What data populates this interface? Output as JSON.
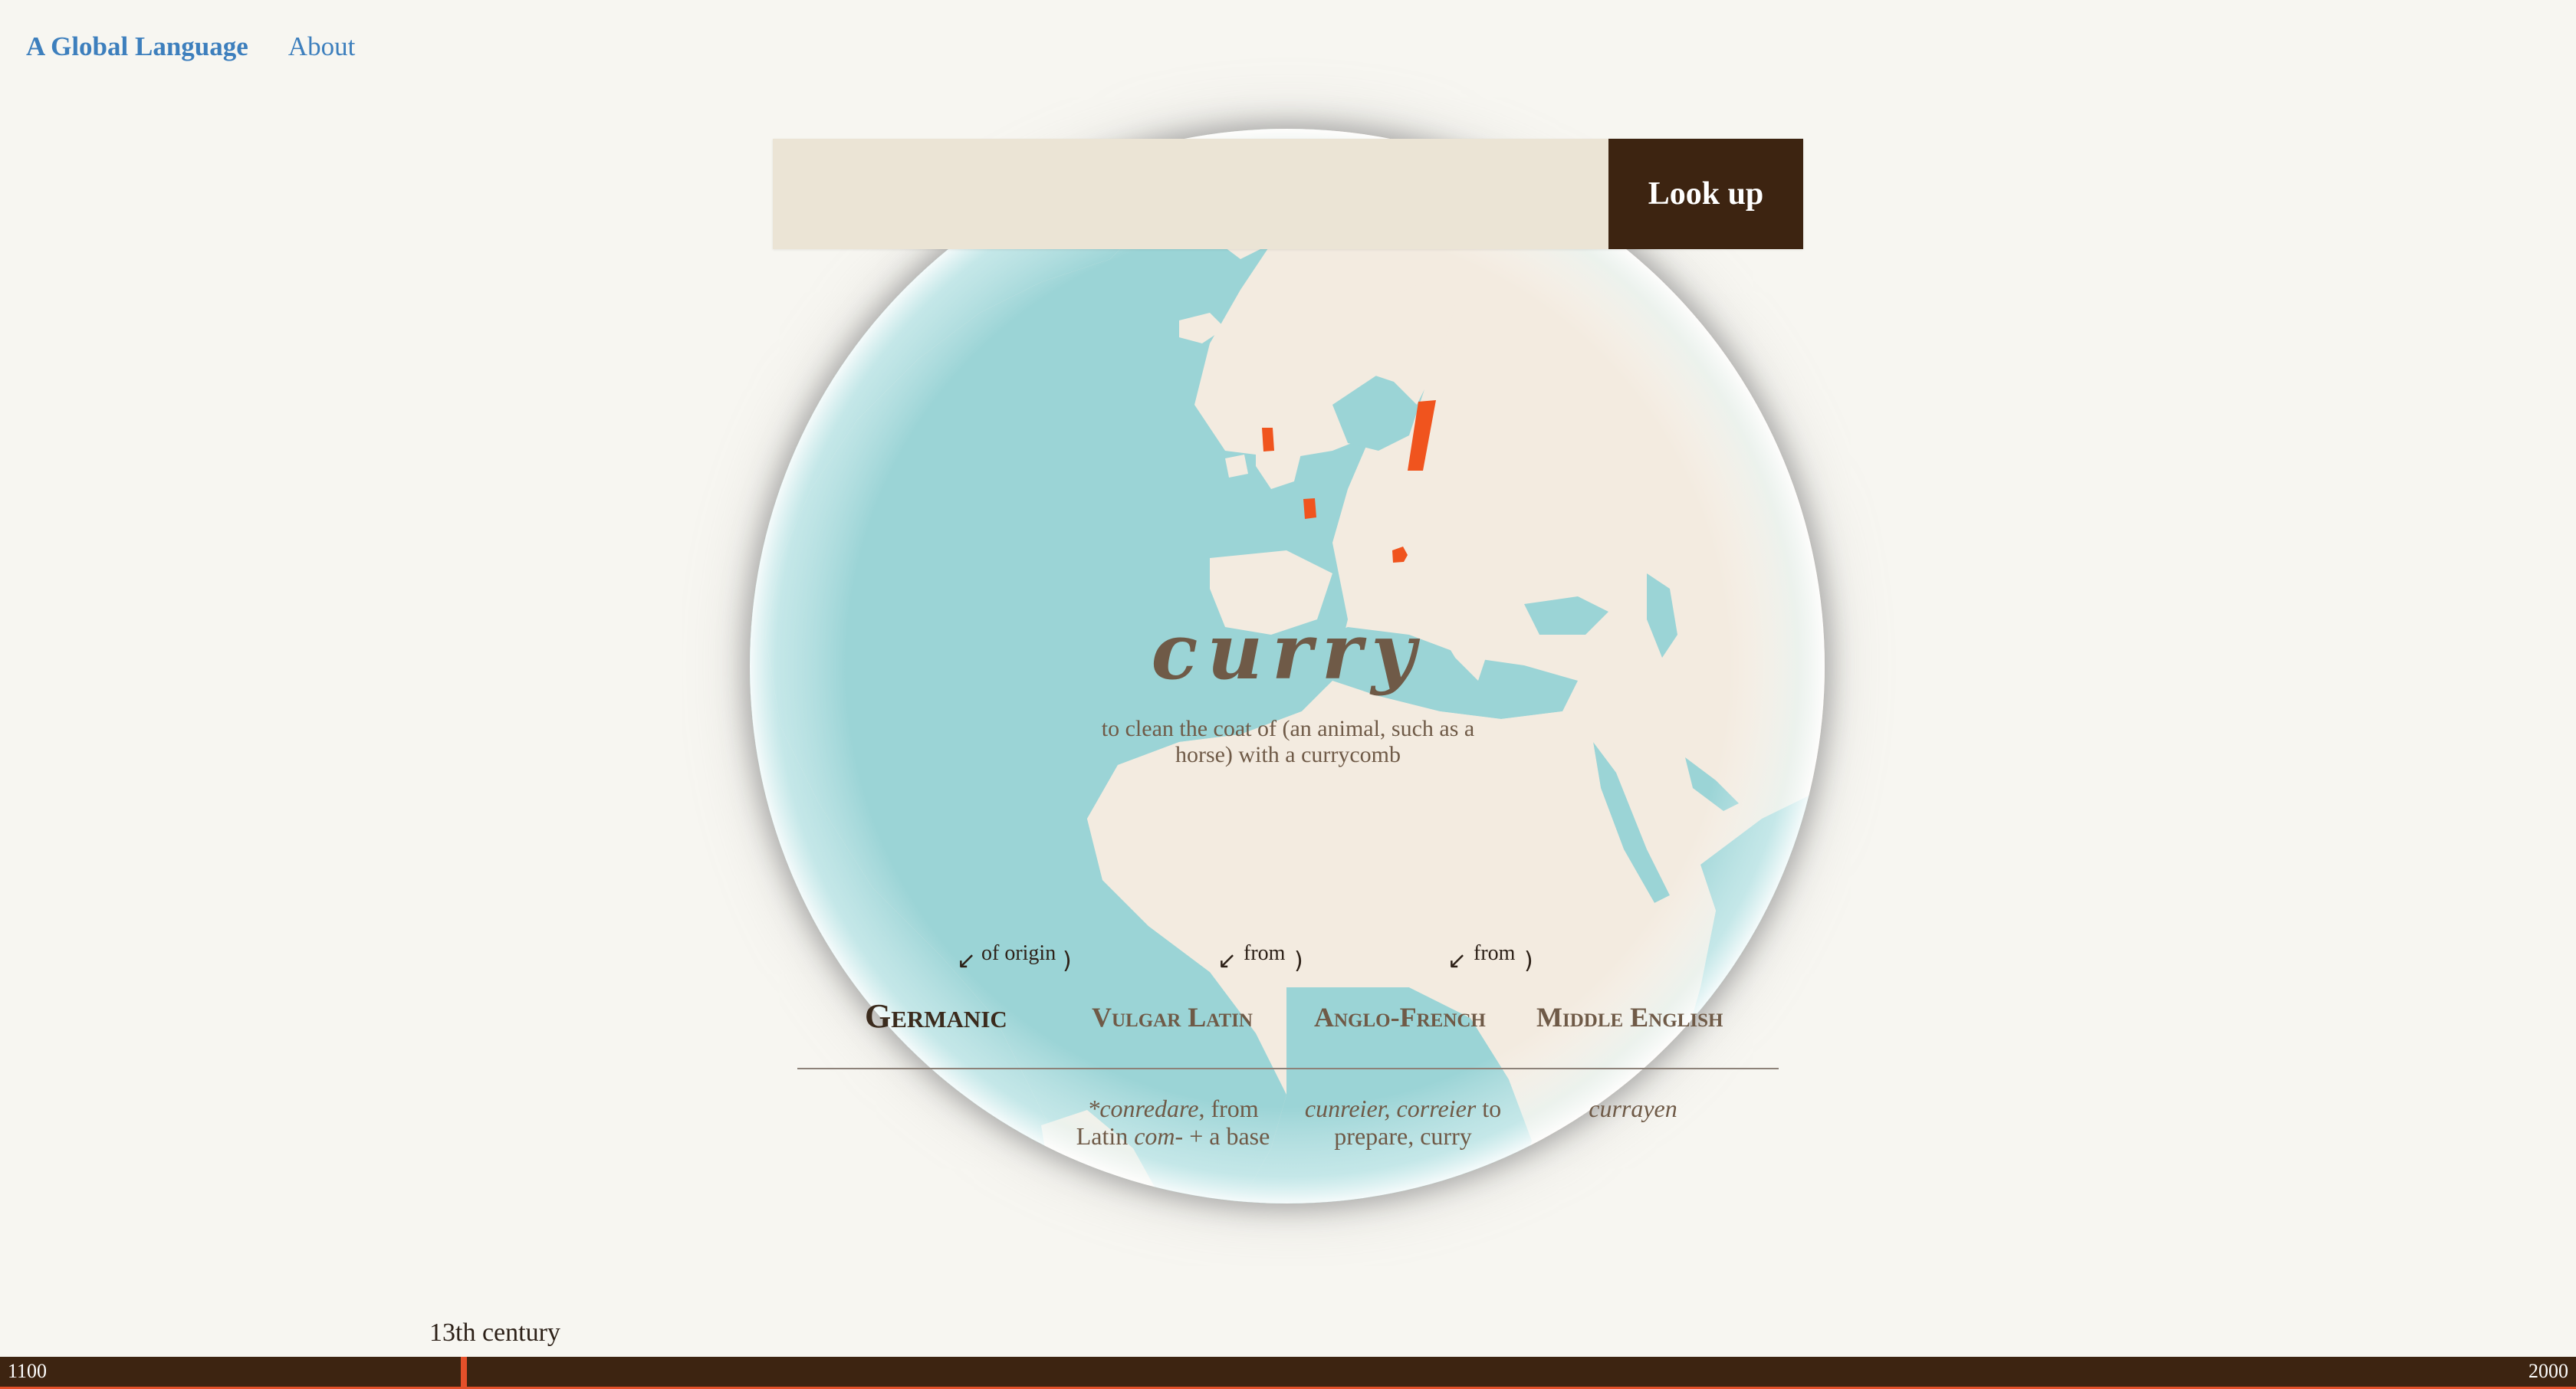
{
  "nav": {
    "brand": "A Global Language",
    "about": "About"
  },
  "search": {
    "value": "",
    "placeholder": "",
    "button_label": "Look up"
  },
  "entry": {
    "word": "curry",
    "definition": "to clean the coat of (an animal, such as a horse) with a currycomb"
  },
  "etymology": {
    "links": [
      "of origin",
      "from",
      "from"
    ],
    "stages": [
      {
        "name": "Germanic",
        "form": ""
      },
      {
        "name": "Vulgar Latin",
        "form_italic": "*conredare",
        "form_rest": ", from Latin ",
        "form_italic2": "com-",
        "form_rest2": " + a base"
      },
      {
        "name": "Anglo-French",
        "form_italic": "cunreier, correier",
        "form_rest": " to prepare, curry"
      },
      {
        "name": "Middle English",
        "form_italic": "currayen"
      }
    ]
  },
  "timeline": {
    "start": "1100",
    "end": "2000",
    "current_label": "13th century",
    "current_fraction": 0.179
  },
  "colors": {
    "accent": "#e4502a",
    "brand_dark": "#3d2411",
    "link": "#3d7fbd",
    "ocean": "#9bd4d6",
    "land": "#f3ebe0",
    "region_highlight": "#f0541e"
  }
}
